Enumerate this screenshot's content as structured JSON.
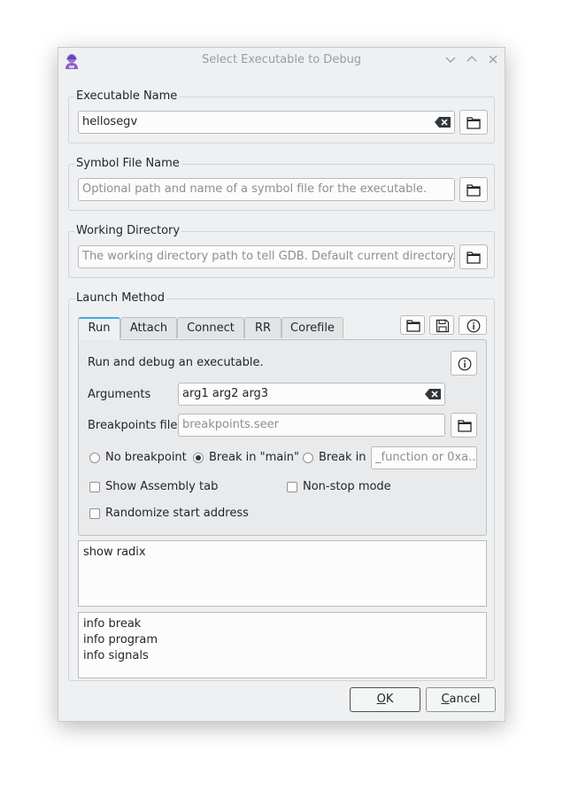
{
  "window": {
    "title": "Select Executable to Debug",
    "controls": [
      "chevron-down",
      "chevron-up",
      "close"
    ]
  },
  "executable": {
    "group_title": "Executable Name",
    "value": "hellosegv"
  },
  "symbol_file": {
    "group_title": "Symbol File Name",
    "placeholder": "Optional path and name of a symbol file for the executable."
  },
  "working_dir": {
    "group_title": "Working Directory",
    "placeholder": "The working directory path to tell GDB. Default current directory."
  },
  "launch": {
    "group_title": "Launch Method",
    "tabs": [
      "Run",
      "Attach",
      "Connect",
      "RR",
      "Corefile"
    ],
    "active_tab": "Run",
    "run": {
      "description": "Run and debug an executable.",
      "arguments_label": "Arguments",
      "arguments_value": "arg1 arg2 arg3",
      "breakpoints_label": "Breakpoints file",
      "breakpoints_placeholder": "breakpoints.seer",
      "radio_no_breakpoint": "No breakpoint",
      "radio_break_main": "Break in \"main\"",
      "radio_break_in": "Break in",
      "break_in_placeholder": "_function or 0xa...",
      "selected_radio": "Break in \"main\"",
      "show_assembly": "Show Assembly tab",
      "non_stop": "Non-stop mode",
      "randomize": "Randomize start address"
    }
  },
  "pre_commands": [
    "show radix"
  ],
  "post_commands": [
    "info break",
    "info program",
    "info signals"
  ],
  "buttons": {
    "ok_mnemonic": "O",
    "ok_rest": "K",
    "cancel_mnemonic": "C",
    "cancel_rest": "ancel"
  },
  "colors": {
    "accent": "#3daee9",
    "app_icon": "#8b5fc7"
  }
}
